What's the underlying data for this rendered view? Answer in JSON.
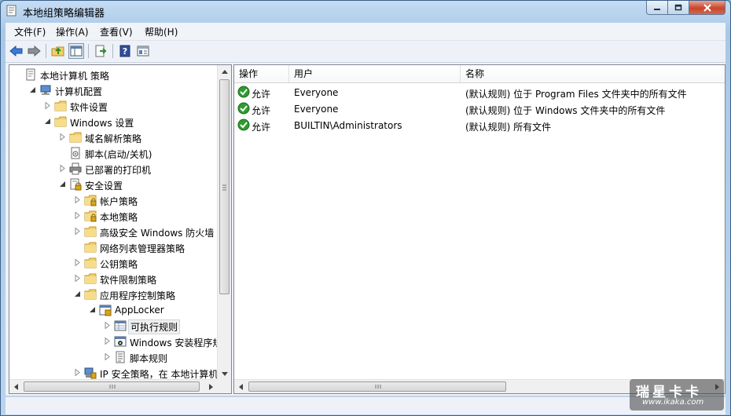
{
  "window": {
    "title": "本地组策略编辑器"
  },
  "menu": [
    "文件(F)",
    "操作(A)",
    "查看(V)",
    "帮助(H)"
  ],
  "toolbar": {
    "buttons": [
      "back-icon",
      "forward-icon",
      "up-folder-icon",
      "show-hide-tree-icon",
      "export-list-icon",
      "help-icon",
      "properties-icon"
    ]
  },
  "tree": {
    "selected": "可执行规则",
    "nodes": [
      {
        "label": "本地计算机 策略",
        "level": 0,
        "expander": "none",
        "icon": "policy-document-icon"
      },
      {
        "label": "计算机配置",
        "level": 1,
        "expander": "expanded",
        "icon": "computer-icon"
      },
      {
        "label": "软件设置",
        "level": 2,
        "expander": "collapsed",
        "icon": "folder-icon"
      },
      {
        "label": "Windows 设置",
        "level": 2,
        "expander": "expanded",
        "icon": "folder-icon"
      },
      {
        "label": "域名解析策略",
        "level": 3,
        "expander": "collapsed",
        "icon": "folder-icon"
      },
      {
        "label": "脚本(启动/关机)",
        "level": 3,
        "expander": "none",
        "icon": "script-icon"
      },
      {
        "label": "已部署的打印机",
        "level": 3,
        "expander": "collapsed",
        "icon": "printer-icon"
      },
      {
        "label": "安全设置",
        "level": 3,
        "expander": "expanded",
        "icon": "security-settings-icon"
      },
      {
        "label": "帐户策略",
        "level": 4,
        "expander": "collapsed",
        "icon": "secure-folder-icon"
      },
      {
        "label": "本地策略",
        "level": 4,
        "expander": "collapsed",
        "icon": "secure-folder-icon"
      },
      {
        "label": "高级安全 Windows 防火墙",
        "level": 4,
        "expander": "collapsed",
        "icon": "folder-icon"
      },
      {
        "label": "网络列表管理器策略",
        "level": 4,
        "expander": "none",
        "icon": "folder-icon"
      },
      {
        "label": "公钥策略",
        "level": 4,
        "expander": "collapsed",
        "icon": "folder-icon"
      },
      {
        "label": "软件限制策略",
        "level": 4,
        "expander": "collapsed",
        "icon": "folder-icon"
      },
      {
        "label": "应用程序控制策略",
        "level": 4,
        "expander": "expanded",
        "icon": "folder-icon"
      },
      {
        "label": "AppLocker",
        "level": 5,
        "expander": "expanded",
        "icon": "applocker-icon"
      },
      {
        "label": "可执行规则",
        "level": 6,
        "expander": "collapsed",
        "icon": "rule-table-icon"
      },
      {
        "label": "Windows 安装程序规则",
        "level": 6,
        "expander": "collapsed",
        "icon": "installer-rule-icon"
      },
      {
        "label": "脚本规则",
        "level": 6,
        "expander": "collapsed",
        "icon": "script-rule-icon"
      },
      {
        "label": "IP 安全策略，在 本地计算机",
        "level": 4,
        "expander": "collapsed",
        "icon": "ip-security-icon"
      }
    ]
  },
  "list": {
    "columns": [
      "操作",
      "用户",
      "名称"
    ],
    "rows": [
      {
        "action": "允许",
        "user": "Everyone",
        "name": "(默认规则) 位于 Program Files 文件夹中的所有文件"
      },
      {
        "action": "允许",
        "user": "Everyone",
        "name": "(默认规则) 位于 Windows 文件夹中的所有文件"
      },
      {
        "action": "允许",
        "user": "BUILTIN\\Administrators",
        "name": "(默认规则) 所有文件"
      }
    ]
  },
  "watermark": {
    "text": "瑞星卡卡",
    "url": "www.ikaka.com"
  },
  "colors": {
    "accent": "#3a7bd5",
    "allow_green": "#2f9b2f",
    "folder": "#f1cf6b"
  }
}
